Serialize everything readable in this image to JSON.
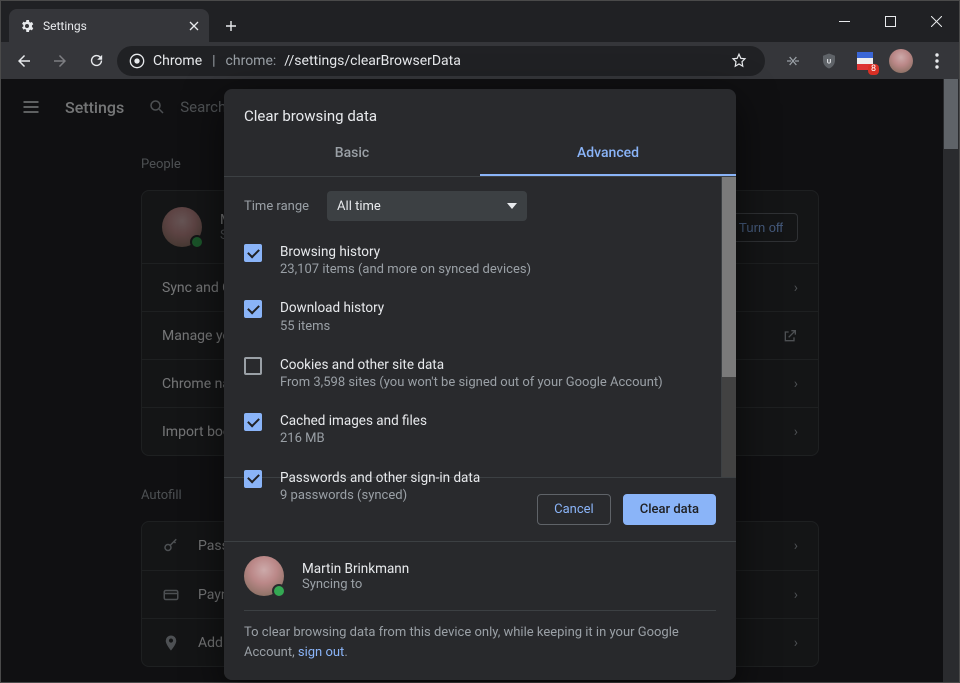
{
  "tab_title": "Settings",
  "omnibox": {
    "title": "Chrome",
    "url_prefix": "chrome:",
    "url_path": "//settings/clearBrowserData"
  },
  "ext_badge": "8",
  "settings": {
    "title": "Settings",
    "search_placeholder": "Search",
    "section_people": "People",
    "turn_off": "Turn off",
    "rows": {
      "sync": "Sync and G",
      "manage": "Manage yo",
      "chromename": "Chrome na",
      "import": "Import boo"
    },
    "section_autofill": "Autofill",
    "autofill_rows": {
      "passwords": "Pass",
      "payments": "Payn",
      "addresses": "Add"
    },
    "user_initial": "M",
    "user_sub": "S"
  },
  "modal": {
    "title": "Clear browsing data",
    "tabs": {
      "basic": "Basic",
      "advanced": "Advanced"
    },
    "time_range_label": "Time range",
    "time_range_value": "All time",
    "items": [
      {
        "checked": true,
        "label": "Browsing history",
        "sub": "23,107 items (and more on synced devices)"
      },
      {
        "checked": true,
        "label": "Download history",
        "sub": "55 items"
      },
      {
        "checked": false,
        "label": "Cookies and other site data",
        "sub": "From 3,598 sites (you won't be signed out of your Google Account)"
      },
      {
        "checked": true,
        "label": "Cached images and files",
        "sub": "216 MB"
      },
      {
        "checked": true,
        "label": "Passwords and other sign-in data",
        "sub": "9 passwords (synced)"
      }
    ],
    "cancel": "Cancel",
    "clear": "Clear data",
    "footer_user": {
      "name": "Martin Brinkmann",
      "status": "Syncing to"
    },
    "footer_note_before": "To clear browsing data from this device only, while keeping it in your Google Account, ",
    "footer_note_link": "sign out",
    "footer_note_after": "."
  }
}
